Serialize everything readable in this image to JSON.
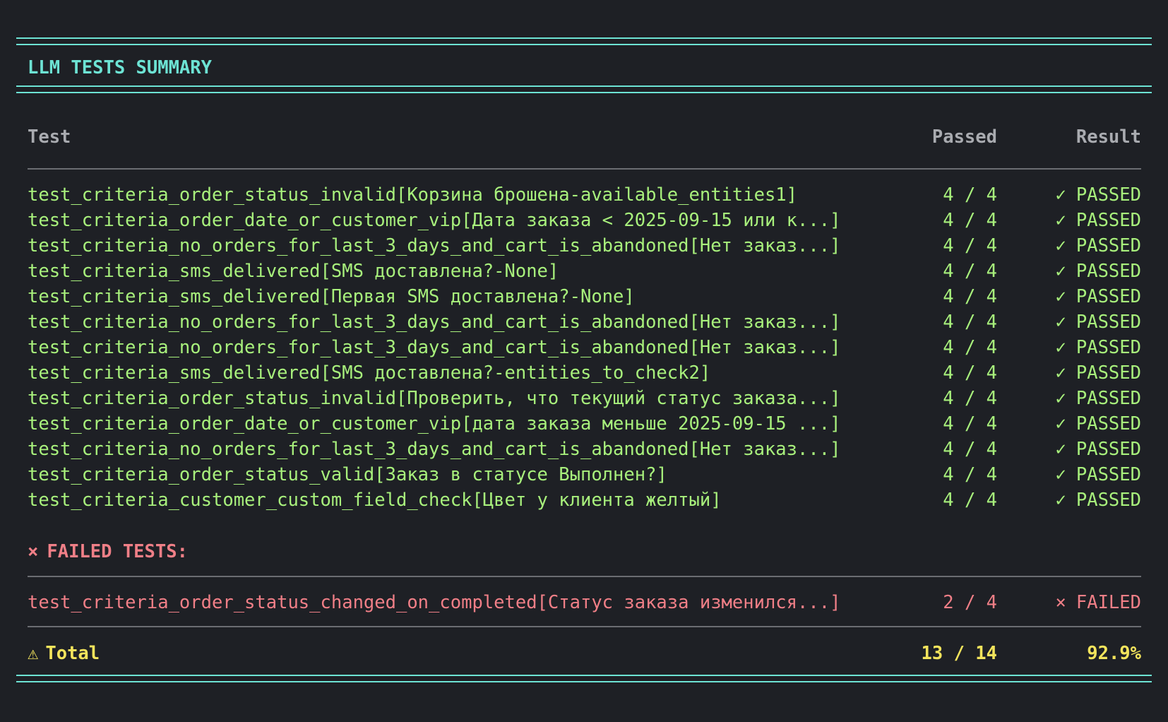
{
  "title": "LLM TESTS SUMMARY",
  "columns": {
    "test": "Test",
    "passed": "Passed",
    "result": "Result"
  },
  "icons": {
    "pass_check": "✓",
    "fail_cross": "×",
    "warning": "⚠"
  },
  "colors": {
    "background": "#1e2025",
    "accent": "#6de3d4",
    "passed": "#a8f07c",
    "failed": "#f07f87",
    "total": "#f3e45c"
  },
  "passed_tests": [
    {
      "name": "test_criteria_order_status_invalid[Корзина брошена-available_entities1]",
      "passed": "4 / 4",
      "result": "PASSED"
    },
    {
      "name": "test_criteria_order_date_or_customer_vip[Дата заказа < 2025-09-15 или к...]",
      "passed": "4 / 4",
      "result": "PASSED"
    },
    {
      "name": "test_criteria_no_orders_for_last_3_days_and_cart_is_abandoned[Нет заказ...]",
      "passed": "4 / 4",
      "result": "PASSED"
    },
    {
      "name": "test_criteria_sms_delivered[SMS доставлена?-None]",
      "passed": "4 / 4",
      "result": "PASSED"
    },
    {
      "name": "test_criteria_sms_delivered[Первая SMS доставлена?-None]",
      "passed": "4 / 4",
      "result": "PASSED"
    },
    {
      "name": "test_criteria_no_orders_for_last_3_days_and_cart_is_abandoned[Нет заказ...]",
      "passed": "4 / 4",
      "result": "PASSED"
    },
    {
      "name": "test_criteria_no_orders_for_last_3_days_and_cart_is_abandoned[Нет заказ...]",
      "passed": "4 / 4",
      "result": "PASSED"
    },
    {
      "name": "test_criteria_sms_delivered[SMS доставлена?-entities_to_check2]",
      "passed": "4 / 4",
      "result": "PASSED"
    },
    {
      "name": "test_criteria_order_status_invalid[Проверить, что текущий статус заказа...]",
      "passed": "4 / 4",
      "result": "PASSED"
    },
    {
      "name": "test_criteria_order_date_or_customer_vip[дата заказа меньше 2025-09-15 ...]",
      "passed": "4 / 4",
      "result": "PASSED"
    },
    {
      "name": "test_criteria_no_orders_for_last_3_days_and_cart_is_abandoned[Нет заказ...]",
      "passed": "4 / 4",
      "result": "PASSED"
    },
    {
      "name": "test_criteria_order_status_valid[Заказ в статусе Выполнен?]",
      "passed": "4 / 4",
      "result": "PASSED"
    },
    {
      "name": "test_criteria_customer_custom_field_check[Цвет у клиента желтый]",
      "passed": "4 / 4",
      "result": "PASSED"
    }
  ],
  "failed_heading": "FAILED TESTS:",
  "failed_tests": [
    {
      "name": "test_criteria_order_status_changed_on_completed[Статус заказа изменился...]",
      "passed": "2 / 4",
      "result": "FAILED"
    }
  ],
  "total": {
    "label": "Total",
    "passed": "13 / 14",
    "percent": "92.9%"
  }
}
